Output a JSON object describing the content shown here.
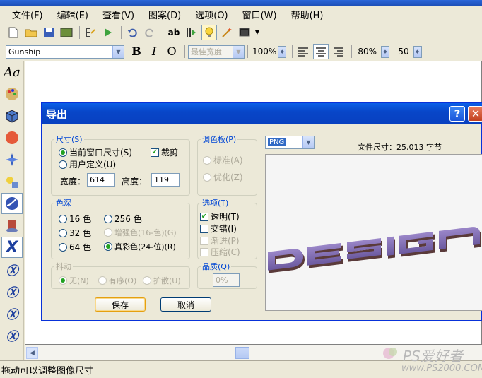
{
  "menubar": {
    "items": [
      {
        "label": "文件(F)"
      },
      {
        "label": "编辑(E)"
      },
      {
        "label": "查看(V)"
      },
      {
        "label": "图案(D)"
      },
      {
        "label": "选项(O)"
      },
      {
        "label": "窗口(W)"
      },
      {
        "label": "帮助(H)"
      }
    ]
  },
  "format_toolbar": {
    "font_name": "Gunship",
    "bold": "B",
    "italic": "I",
    "outline": "O",
    "best_width": "最佳宽度",
    "zoom": "100%",
    "scale": "80%",
    "offset": "-50"
  },
  "left_tools": {
    "text_tool": "Aa"
  },
  "dialog": {
    "title": "导出",
    "help": "?",
    "close": "✕",
    "size_group": {
      "legend": "尺寸(S)",
      "current_window": "当前窗口尺寸(S)",
      "crop": "裁剪",
      "custom": "用户定义(U)",
      "width_label": "宽度：",
      "width_value": "614",
      "height_label": "高度：",
      "height_value": "119"
    },
    "palette_group": {
      "legend": "调色板(P)",
      "standard": "标准(A)",
      "optimized": "优化(Z)"
    },
    "color_depth_group": {
      "legend": "色深",
      "c16": "16 色",
      "c256": "256 色",
      "c32": "32 色",
      "enhanced16": "增强色(16-色)(G)",
      "c64": "64 色",
      "truecolor": "真彩色(24-位)(R)"
    },
    "options_group": {
      "legend": "选项(T)",
      "transparent": "透明(T)",
      "interlace": "交错(I)",
      "progressive": "渐进(P)",
      "compress": "压缩(C)"
    },
    "dither_group": {
      "legend": "抖动",
      "none": "无(N)",
      "ordered": "有序(O)",
      "diffuse": "扩散(U)"
    },
    "quality_group": {
      "legend": "品质(Q)",
      "value": "0%"
    },
    "format_value": "PNG",
    "file_size_label": "文件尺寸：25,013 字节",
    "save_button": "保存",
    "cancel_button": "取消"
  },
  "status": {
    "text": "拖动可以调整图像尺寸"
  },
  "watermark": {
    "brand": "PS爱好者",
    "url": "www.PS2000.COM"
  }
}
